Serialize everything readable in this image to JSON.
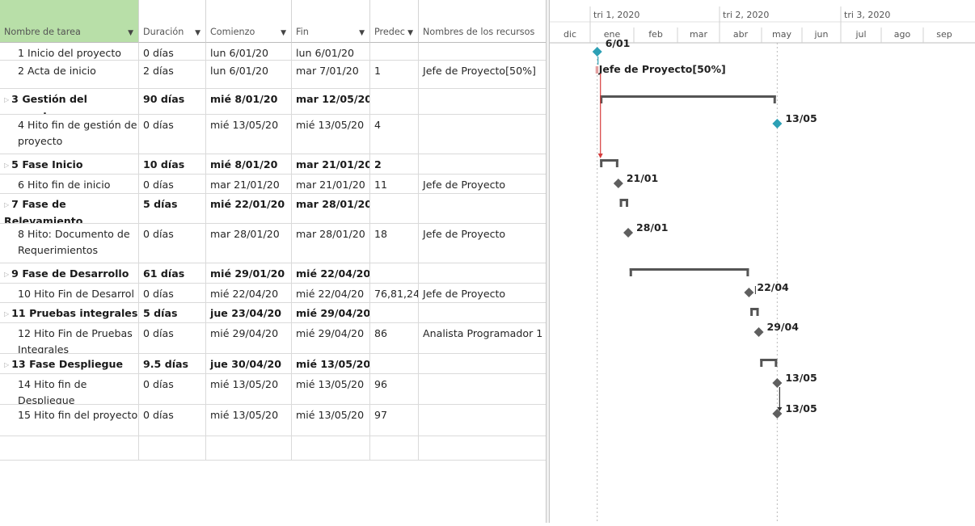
{
  "columns": [
    {
      "key": "name",
      "label": "Nombre de tarea",
      "has_filter": true,
      "selected": true
    },
    {
      "key": "duration",
      "label": "Duración",
      "has_filter": true
    },
    {
      "key": "start",
      "label": "Comienzo",
      "has_filter": true
    },
    {
      "key": "finish",
      "label": "Fin",
      "has_filter": true
    },
    {
      "key": "pred",
      "label": "Predec",
      "has_filter": true
    },
    {
      "key": "resources",
      "label": "Nombres de los recursos",
      "has_filter": false
    }
  ],
  "tasks": [
    {
      "id": "1",
      "name": "Inicio del proyecto",
      "duration": "0 días",
      "start": "lun 6/01/20",
      "finish": "lun 6/01/20",
      "pred": "",
      "resources": "",
      "summary": false
    },
    {
      "id": "2",
      "name": "Acta de inicio",
      "duration": "2 días",
      "start": "lun 6/01/20",
      "finish": "mar 7/01/20",
      "pred": "1",
      "resources": "Jefe de Proyecto[50%]",
      "summary": false
    },
    {
      "id": "3",
      "name": "Gestión del proyecto",
      "duration": "90 días",
      "start": "mié 8/01/20",
      "finish": "mar 12/05/20",
      "pred": "",
      "resources": "",
      "summary": true
    },
    {
      "id": "4",
      "name": "Hito fin de gestión de proyecto",
      "duration": "0 días",
      "start": "mié 13/05/20",
      "finish": "mié 13/05/20",
      "pred": "4",
      "resources": "",
      "summary": false
    },
    {
      "id": "5",
      "name": "Fase Inicio",
      "duration": "10 días",
      "start": "mié 8/01/20",
      "finish": "mar 21/01/20",
      "pred": "2",
      "resources": "",
      "summary": true
    },
    {
      "id": "6",
      "name": "Hito fin de inicio",
      "duration": "0 días",
      "start": "mar 21/01/20",
      "finish": "mar 21/01/20",
      "pred": "11",
      "resources": "Jefe de Proyecto",
      "summary": false
    },
    {
      "id": "7",
      "name": "Fase de Relevamiento",
      "duration": "5 días",
      "start": "mié 22/01/20",
      "finish": "mar 28/01/20",
      "pred": "",
      "resources": "",
      "summary": true
    },
    {
      "id": "8",
      "name": "Hito: Documento de Requerimientos",
      "duration": "0 días",
      "start": "mar 28/01/20",
      "finish": "mar 28/01/20",
      "pred": "18",
      "resources": "Jefe de Proyecto",
      "summary": false
    },
    {
      "id": "9",
      "name": "Fase de Desarrollo",
      "duration": "61 días",
      "start": "mié 29/01/20",
      "finish": "mié 22/04/20",
      "pred": "",
      "resources": "",
      "summary": true
    },
    {
      "id": "10",
      "name": "Hito Fin de Desarrol",
      "duration": "0 días",
      "start": "mié 22/04/20",
      "finish": "mié 22/04/20",
      "pred": "76,81,24,",
      "resources": "Jefe de Proyecto",
      "summary": false
    },
    {
      "id": "11",
      "name": "Pruebas integrales",
      "duration": "5 días",
      "start": "jue 23/04/20",
      "finish": "mié 29/04/20",
      "pred": "",
      "resources": "",
      "summary": true
    },
    {
      "id": "12",
      "name": "Hito Fin de Pruebas Integrales",
      "duration": "0 días",
      "start": "mié 29/04/20",
      "finish": "mié 29/04/20",
      "pred": "86",
      "resources": "Analista Programador 1",
      "summary": false
    },
    {
      "id": "13",
      "name": "Fase Despliegue",
      "duration": "9.5 días",
      "start": "jue 30/04/20",
      "finish": "mié 13/05/20",
      "pred": "",
      "resources": "",
      "summary": true
    },
    {
      "id": "14",
      "name": "Hito fin de Despliegue",
      "duration": "0 días",
      "start": "mié 13/05/20",
      "finish": "mié 13/05/20",
      "pred": "96",
      "resources": "",
      "summary": false
    },
    {
      "id": "15",
      "name": "Hito fin del proyecto",
      "duration": "0 días",
      "start": "mié 13/05/20",
      "finish": "mié 13/05/20",
      "pred": "97",
      "resources": "",
      "summary": false
    }
  ],
  "timescale": {
    "quarters": [
      "tri 1, 2020",
      "tri 2, 2020",
      "tri 3, 2020"
    ],
    "months": [
      "dic",
      "ene",
      "feb",
      "mar",
      "abr",
      "may",
      "jun",
      "jul",
      "ago",
      "sep"
    ]
  },
  "gantt": {
    "milestone_labels": [
      {
        "row": 1,
        "text": "6/01"
      },
      {
        "row": 4,
        "text": "13/05"
      },
      {
        "row": 6,
        "text": "21/01"
      },
      {
        "row": 8,
        "text": "28/01"
      },
      {
        "row": 10,
        "text": "22/04"
      },
      {
        "row": 12,
        "text": "29/04"
      },
      {
        "row": 14,
        "text": "13/05"
      },
      {
        "row": 15,
        "text": "13/05"
      }
    ],
    "resource_label": {
      "row": 2,
      "text": "Jefe de Proyecto[50%]"
    }
  },
  "colors": {
    "header_selected": "#b8dfa8",
    "summary_bar": "#555555",
    "milestone": "#5f5f5f",
    "milestone_first": "#2ca0b5",
    "critical_link": "#d63b3b",
    "task_bar": "#e4a0a0"
  }
}
